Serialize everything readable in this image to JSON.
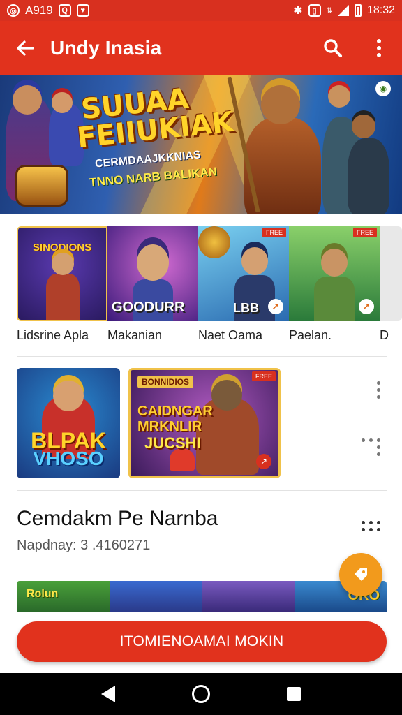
{
  "status_bar": {
    "left_text": "A919",
    "time": "18:32",
    "icons": [
      "notification-icon",
      "sim-icon",
      "alarm-icon",
      "vibrate-icon",
      "wifi-icon",
      "signal-icon",
      "battery-icon"
    ]
  },
  "app_bar": {
    "title": "Undy Inasia",
    "back_icon": "arrow-left-icon",
    "search_icon": "search-icon",
    "more_icon": "more-vert-icon"
  },
  "hero": {
    "title_line1": "SUUAA",
    "title_line2": "FEIIUKIAK",
    "tagline1": "CERMDAAJKKNIAS",
    "tagline2": "TNNO NARB BALIKAN"
  },
  "games": [
    {
      "name": "Lidsrine Apla",
      "art_label_top": "SINODIONS",
      "art_label_bottom": "",
      "badge": ""
    },
    {
      "name": "Makanian",
      "art_label_top": "",
      "art_label_bottom": "GOODURR",
      "badge": ""
    },
    {
      "name": "Naet Oama",
      "art_label_top": "",
      "art_label_bottom": "LBB",
      "badge": "FREE"
    },
    {
      "name": "Paelan.",
      "art_label_top": "",
      "art_label_bottom": "",
      "badge": "FREE"
    },
    {
      "name": "D",
      "art_label_top": "",
      "art_label_bottom": "",
      "badge": ""
    }
  ],
  "featured": [
    {
      "title_line1": "BLPAK",
      "title_line2": "VHOSO"
    },
    {
      "badge": "BONNIDIOS",
      "title_line1": "CAIDNGAR",
      "title_line2": "MRKNLIR",
      "title_line3": "JUCSHI",
      "corner": "FREE"
    }
  ],
  "section": {
    "title": "Cemdakm Pe Narnba",
    "subtitle": "Napdnay: 3 .4160271"
  },
  "bottom_strip": {
    "left_label": "Rolun",
    "right_label": "ORO"
  },
  "cta": {
    "label": "ITOMIENOAMAI MOKIN"
  },
  "colors": {
    "primary": "#e1321d",
    "status": "#d8301f",
    "fab": "#f29a1c"
  }
}
